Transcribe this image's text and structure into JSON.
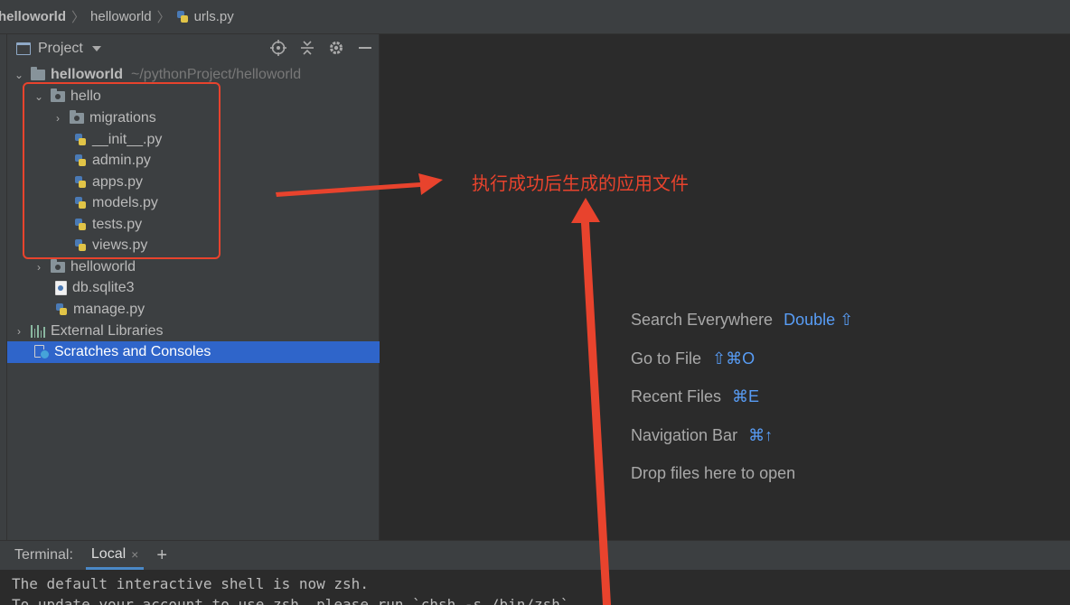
{
  "breadcrumb": [
    "helloworld",
    "helloworld",
    "urls.py"
  ],
  "project_panel": {
    "title": "Project",
    "tree": [
      {
        "label": "helloworld",
        "hint": "~/pythonProject/helloworld",
        "type": "folder",
        "expanded": true,
        "bold": true
      },
      {
        "label": "hello",
        "type": "folder",
        "expanded": true
      },
      {
        "label": "migrations",
        "type": "folder",
        "expanded": false
      },
      {
        "label": "__init__.py",
        "type": "python"
      },
      {
        "label": "admin.py",
        "type": "python"
      },
      {
        "label": "apps.py",
        "type": "python"
      },
      {
        "label": "models.py",
        "type": "python"
      },
      {
        "label": "tests.py",
        "type": "python"
      },
      {
        "label": "views.py",
        "type": "python"
      },
      {
        "label": "helloworld",
        "type": "folder",
        "expanded": false
      },
      {
        "label": "db.sqlite3",
        "type": "database"
      },
      {
        "label": "manage.py",
        "type": "python"
      },
      {
        "label": "External Libraries",
        "type": "library",
        "expanded": false
      },
      {
        "label": "Scratches and Consoles",
        "type": "scratch",
        "selected": true
      }
    ]
  },
  "editor_hints": [
    {
      "label": "Search Everywhere",
      "shortcut": "Double ⇧"
    },
    {
      "label": "Go to File",
      "shortcut": "⇧⌘O"
    },
    {
      "label": "Recent Files",
      "shortcut": "⌘E"
    },
    {
      "label": "Navigation Bar",
      "shortcut": "⌘↑"
    },
    {
      "label": "Drop files here to open",
      "shortcut": ""
    }
  ],
  "annotation": {
    "text": "执行成功后生成的应用文件",
    "color": "#e8432d"
  },
  "terminal": {
    "label": "Terminal:",
    "tab": "Local",
    "add": "+",
    "close": "×",
    "lines": [
      "The default interactive shell is now zsh.",
      "To update your account to use zsh, please run `chsh -s /bin/zsh`."
    ]
  },
  "colors": {
    "selection": "#2f65ca",
    "link": "#589df6",
    "annotation": "#e8432d"
  }
}
